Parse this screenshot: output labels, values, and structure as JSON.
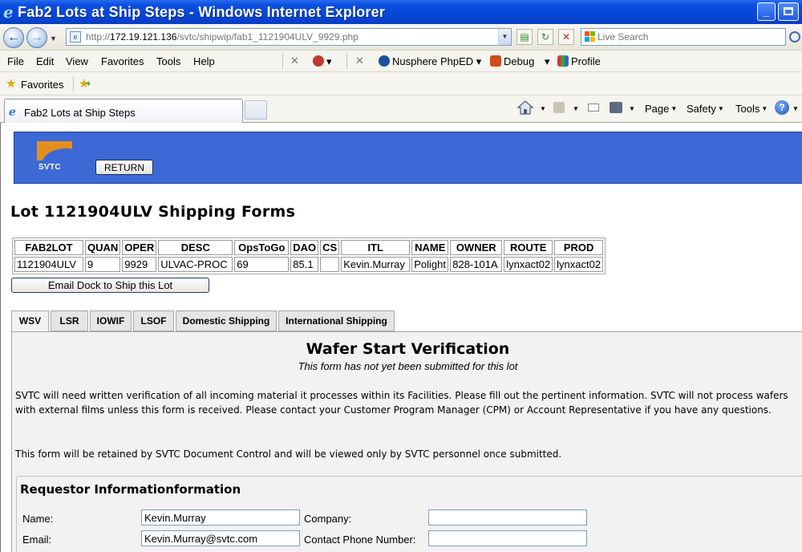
{
  "window": {
    "title": "Fab2 Lots at Ship Steps - Windows Internet Explorer",
    "minimize": "_",
    "maximize": "❐",
    "close": "✕"
  },
  "address": {
    "url_prefix": "http://",
    "url_host": "172.19.121.136",
    "url_path": "/svtc/shipwip/fab1_1121904ULV_9929.php",
    "search_placeholder": "Live Search"
  },
  "menu": {
    "items": [
      "File",
      "Edit",
      "View",
      "Favorites",
      "Tools",
      "Help"
    ],
    "tools": {
      "nusphere": "Nusphere PhpED",
      "debug": "Debug",
      "profile": "Profile"
    }
  },
  "favorites_bar": {
    "label": "Favorites"
  },
  "browser_tab": {
    "label": "Fab2 Lots at Ship Steps"
  },
  "command_bar": {
    "page": "Page",
    "safety": "Safety",
    "tools": "Tools"
  },
  "banner": {
    "logo_text": "SVTC",
    "return_label": "RETURN"
  },
  "page_title": "Lot 1121904ULV Shipping Forms",
  "lot_table": {
    "headers": [
      "FAB2LOT",
      "QUAN",
      "OPER",
      "DESC",
      "OpsToGo",
      "DAO",
      "CS",
      "ITL",
      "NAME",
      "OWNER",
      "ROUTE",
      "PROD"
    ],
    "rows": [
      [
        "1121904ULV",
        "9",
        "9929",
        "ULVAC-PROC",
        "69",
        "85.1",
        "",
        "Kevin.Murray",
        "Polight",
        "828-101A",
        "lynxact02",
        "lynxact02"
      ]
    ]
  },
  "email_button": "Email Dock to Ship this Lot",
  "form_tabs": [
    "WSV",
    "LSR",
    "IOWIF",
    "LSOF",
    "Domestic Shipping",
    "International Shipping"
  ],
  "wsv": {
    "title": "Wafer Start Verification",
    "subtitle": "This form has not yet been submitted for this lot",
    "para1": "SVTC will need written verification of all incoming material it processes within its Facilities. Please fill out the pertinent information. SVTC will not process wafers with external films unless this form is received. Please contact your Customer Program Manager (CPM) or Account Representative if you have any questions.",
    "para2": "This form will be retained by SVTC Document Control and will be viewed only by SVTC personnel once submitted.",
    "section_title": "Requestor Informationformation",
    "fields": {
      "name_label": "Name:",
      "name_value": "Kevin.Murray",
      "company_label": "Company:",
      "company_value": "",
      "email_label": "Email:",
      "email_value": "Kevin.Murray@svtc.com",
      "phone_label": "Contact Phone Number:",
      "phone_value": ""
    }
  }
}
